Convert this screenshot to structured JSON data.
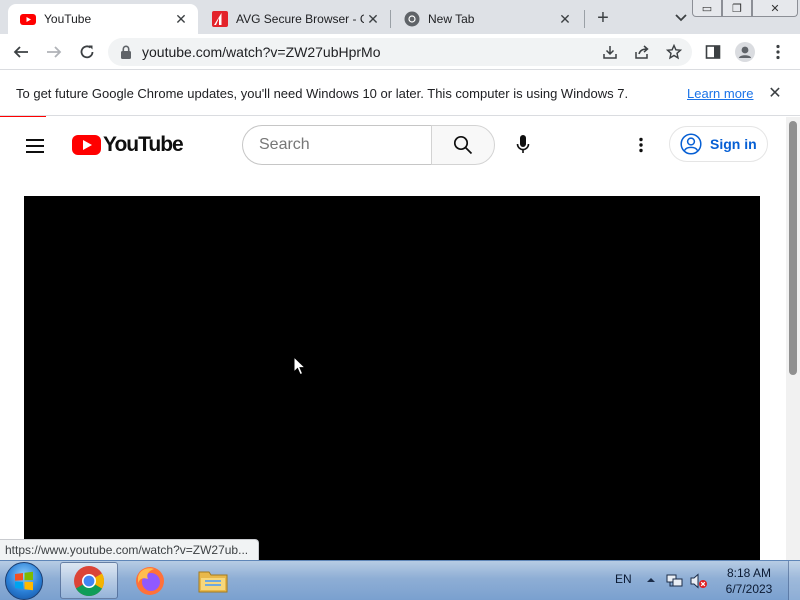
{
  "browser": {
    "tabs": [
      {
        "title": "YouTube",
        "icon": "youtube-icon",
        "active": true
      },
      {
        "title": "AVG Secure Browser - C",
        "icon": "avg-icon",
        "active": false
      },
      {
        "title": "New Tab",
        "icon": "chrome-icon",
        "active": false
      }
    ],
    "new_tab_symbol": "+",
    "close_symbol": "✕",
    "url": "youtube.com/watch?v=ZW27ubHprMo",
    "window_controls": {
      "minimize": "▭",
      "maximize": "❐",
      "close": "✕"
    }
  },
  "infobar": {
    "message": "To get future Google Chrome updates, you'll need Windows 10 or later. This computer is using Windows 7.",
    "link": "Learn more",
    "close_symbol": "✕"
  },
  "youtube": {
    "logo_text": "YouTube",
    "search_placeholder": "Search",
    "signin_label": "Sign in"
  },
  "status_bar": {
    "url": "https://www.youtube.com/watch?v=ZW27ub..."
  },
  "taskbar": {
    "pinned": [
      "chrome-icon",
      "firefox-icon",
      "file-explorer-icon"
    ],
    "language": "EN",
    "clock_time": "8:18 AM",
    "clock_date": "6/7/2023"
  },
  "colors": {
    "youtube_red": "#ff0000",
    "link_blue": "#1a73e8",
    "signin_blue": "#065fd4",
    "tabstrip_bg": "#dee1e6",
    "player_bg": "#000000"
  }
}
